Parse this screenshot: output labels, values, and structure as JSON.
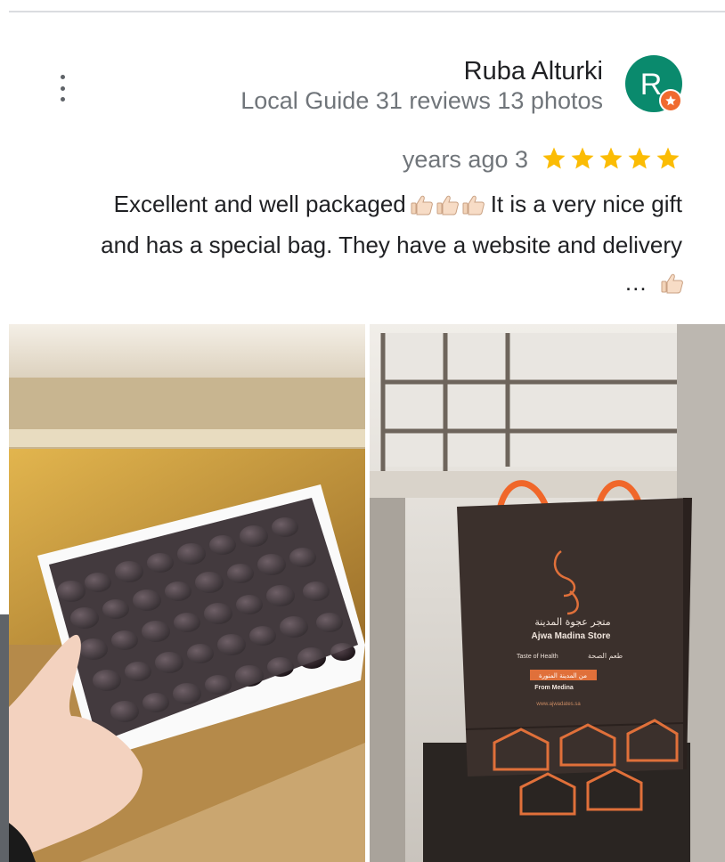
{
  "review": {
    "author": "Ruba Alturki",
    "meta": "Local Guide 31 reviews 13 photos",
    "avatar_letter": "R",
    "time": "years ago 3",
    "rating": 5,
    "text_line1": "Excellent and well packaged",
    "text_line1b": "It is a very nice gift",
    "text_line2": "and has a special bag. They have a website and delivery",
    "ellipsis": "…"
  },
  "photos": {
    "bag_brand_arabic": "متجر عجوة المدينة",
    "bag_brand": "Ajwa Madina Store",
    "bag_taste_en": "Taste of Health",
    "bag_taste_ar": "طعم الصحة",
    "bag_from_ar": "من المدينة المنورة",
    "bag_from_en": "From Medina",
    "bag_url": "www.ajwadates.sa"
  },
  "colors": {
    "star": "#fbbc04",
    "avatar": "#0a8a6d",
    "badge": "#f06a2f",
    "bag": "#3b302c",
    "bag_accent": "#e0703a"
  }
}
